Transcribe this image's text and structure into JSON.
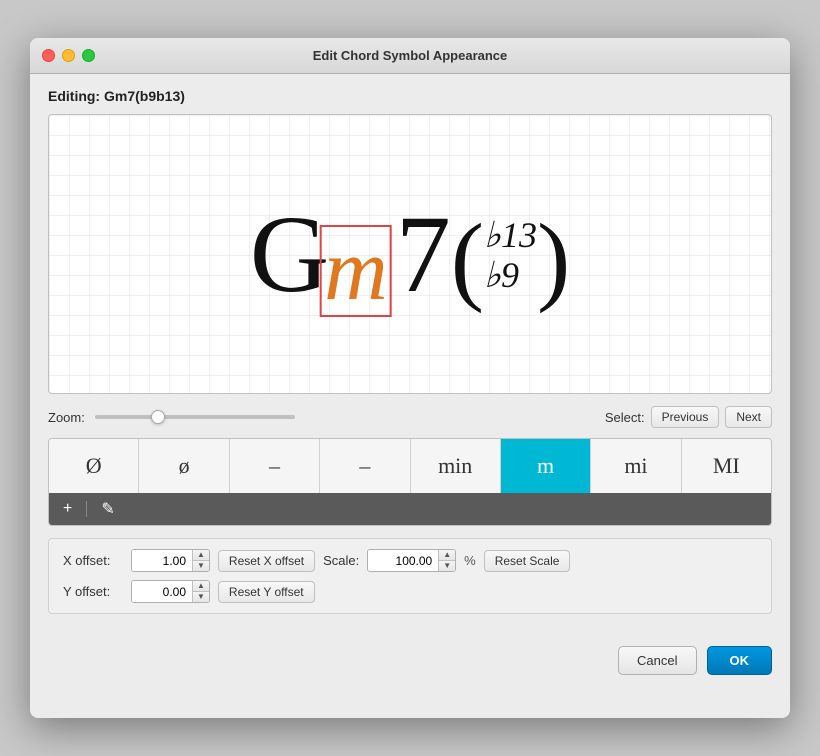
{
  "window": {
    "title": "Edit Chord Symbol Appearance"
  },
  "editing": {
    "label": "Editing:",
    "chord": "Gm7(b9b13)"
  },
  "zoom": {
    "label": "Zoom:"
  },
  "select": {
    "label": "Select:",
    "previous": "Previous",
    "next": "Next"
  },
  "tokens": [
    {
      "id": "dim-circle",
      "symbol": "Ø",
      "selected": false
    },
    {
      "id": "half-dim",
      "symbol": "ø",
      "selected": false
    },
    {
      "id": "dash1",
      "symbol": "–",
      "selected": false
    },
    {
      "id": "dash2",
      "symbol": "–",
      "selected": false
    },
    {
      "id": "min",
      "symbol": "min",
      "selected": false
    },
    {
      "id": "m",
      "symbol": "m",
      "selected": true
    },
    {
      "id": "mi",
      "symbol": "mi",
      "selected": false
    },
    {
      "id": "MI",
      "symbol": "MI",
      "selected": false
    }
  ],
  "toolbar": {
    "add_icon": "+",
    "edit_icon": "✎"
  },
  "offsets": {
    "x_label": "X offset:",
    "x_value": "1.00",
    "x_reset": "Reset X offset",
    "scale_label": "Scale:",
    "scale_value": "100.00",
    "scale_percent": "%",
    "scale_reset": "Reset Scale",
    "y_label": "Y offset:",
    "y_value": "0.00",
    "y_reset": "Reset Y offset"
  },
  "footer": {
    "cancel": "Cancel",
    "ok": "OK"
  }
}
